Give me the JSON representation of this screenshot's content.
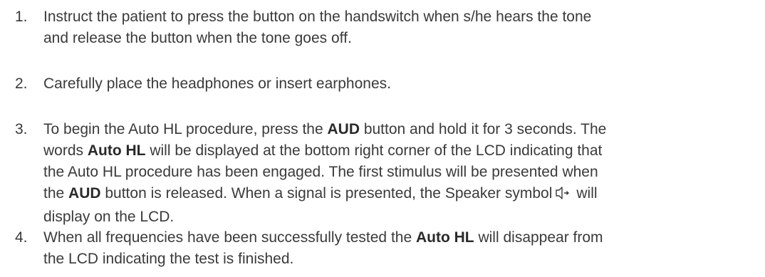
{
  "steps": [
    {
      "number": "1.",
      "lines": [
        "Instruct the patient to press the button on the handswitch when s/he hears the tone",
        "and release the button when the tone goes off."
      ]
    },
    {
      "number": "2.",
      "lines": [
        "Carefully place the headphones or insert earphones."
      ]
    },
    {
      "number": "3.",
      "line1": {
        "a": "To begin the Auto HL procedure, press the ",
        "b": "AUD",
        "c": " button and hold it for 3 seconds. The"
      },
      "line2": {
        "a": "words ",
        "b": "Auto HL",
        "c": " will be displayed at the bottom right corner of the LCD indicating that"
      },
      "line3": "the Auto HL procedure has been engaged. The first stimulus will be presented when",
      "line4": {
        "a": "the ",
        "b": "AUD",
        "c": " button is released. When a signal is presented, the Speaker symbol",
        "d": "will"
      },
      "line5": "display on the LCD.",
      "icon": "speaker-icon"
    },
    {
      "number": "4.",
      "line1": {
        "a": "When all frequencies have been successfully tested the ",
        "b": "Auto HL",
        "c": " will disappear from"
      },
      "line2": "the LCD indicating the test is finished."
    }
  ]
}
